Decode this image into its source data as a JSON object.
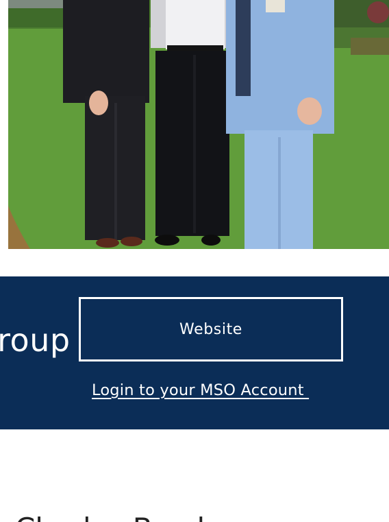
{
  "photo": {
    "alt_subject": "three-men-on-lawn",
    "colors": {
      "grass": "#5f9a3a",
      "dark_suit": "#1d1d22",
      "light_blue_suit": "#8fb3df",
      "brick": "#b35a3c"
    }
  },
  "banner": {
    "background": "#0b2d57",
    "heading": "Group",
    "website_button_label": "Website",
    "login_link_label": "Login to your MSO Account "
  },
  "section": {
    "heading": "Charles Brock"
  }
}
